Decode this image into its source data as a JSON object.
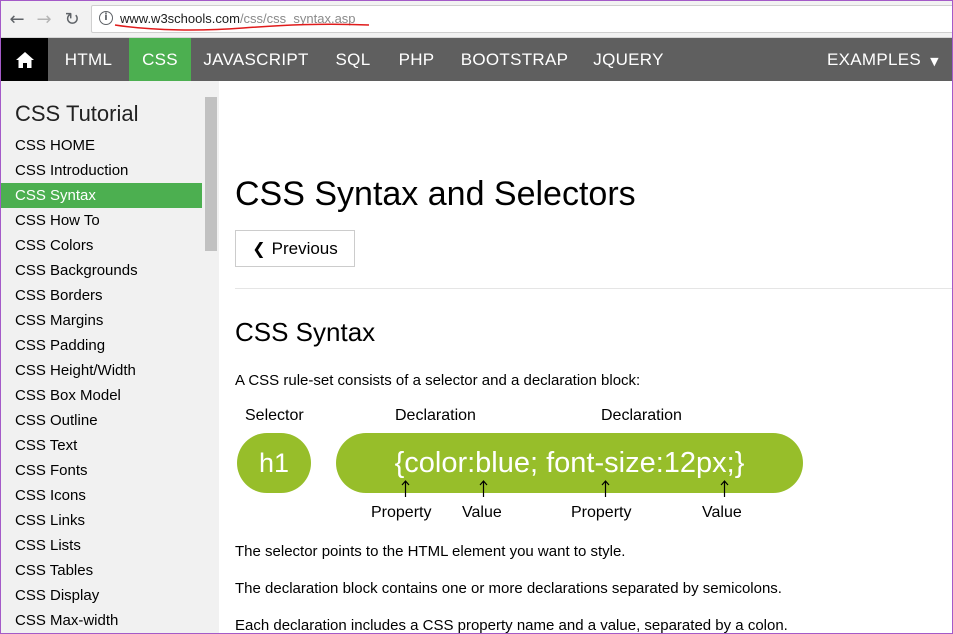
{
  "browser": {
    "url_host": "www.w3schools.com",
    "url_path": "/css/css_syntax.asp"
  },
  "topnav": {
    "items": [
      "HTML",
      "CSS",
      "JAVASCRIPT",
      "SQL",
      "PHP",
      "BOOTSTRAP",
      "JQUERY"
    ],
    "active": "CSS",
    "examples": "EXAMPLES"
  },
  "sidebar": {
    "title": "CSS Tutorial",
    "items": [
      "CSS HOME",
      "CSS Introduction",
      "CSS Syntax",
      "CSS How To",
      "CSS Colors",
      "CSS Backgrounds",
      "CSS Borders",
      "CSS Margins",
      "CSS Padding",
      "CSS Height/Width",
      "CSS Box Model",
      "CSS Outline",
      "CSS Text",
      "CSS Fonts",
      "CSS Icons",
      "CSS Links",
      "CSS Lists",
      "CSS Tables",
      "CSS Display",
      "CSS Max-width"
    ],
    "active": "CSS Syntax"
  },
  "main": {
    "title": "CSS Syntax and Selectors",
    "previous_label": "Previous",
    "section_title": "CSS Syntax",
    "intro": "A CSS rule-set consists of a selector and a declaration block:",
    "diagram": {
      "selector_label": "Selector",
      "declaration_label_1": "Declaration",
      "declaration_label_2": "Declaration",
      "selector_code": "h1",
      "declaration_code": "{color:blue; font-size:12px;}",
      "property_label_1": "Property",
      "value_label_1": "Value",
      "property_label_2": "Property",
      "value_label_2": "Value",
      "pill_color": "#97be2a"
    },
    "paragraphs": [
      "The selector points to the HTML element you want to style.",
      "The declaration block contains one or more declarations separated by semicolons.",
      "Each declaration includes a CSS property name and a value, separated by a colon."
    ]
  },
  "colors": {
    "accent": "#4caf50",
    "nav_bg": "#5f5f5f",
    "sidebar_bg": "#f1f1f1"
  }
}
